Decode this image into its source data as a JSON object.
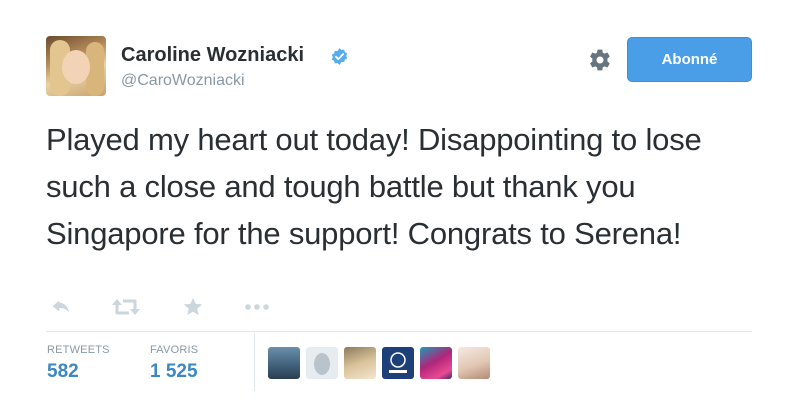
{
  "user": {
    "name": "Caroline Wozniacki",
    "handle": "@CaroWozniacki",
    "verified_icon": "verified-badge-icon",
    "avatar_icon": "profile-photo"
  },
  "header": {
    "settings_icon": "gear-icon",
    "follow_label": "Abonné",
    "follow_color": "#4a9ee8"
  },
  "tweet": {
    "text": "Played my heart out today! Disappointing to lose such a close and tough battle but thank you Singapore for the support! Congrats to Serena!"
  },
  "actions": [
    "reply-icon",
    "retweet-icon",
    "favorite-icon",
    "more-icon"
  ],
  "stats": {
    "retweets_label": "RETWEETS",
    "retweets_value": "582",
    "favorites_label": "FAVORIS",
    "favorites_value": "1 525"
  },
  "favorited_by": [
    "favoriter-avatar-1",
    "favoriter-avatar-2",
    "favoriter-avatar-3",
    "favoriter-avatar-4",
    "favoriter-avatar-5",
    "favoriter-avatar-6"
  ],
  "colors": {
    "text": "#292f33",
    "muted": "#8899a6",
    "link": "#3b88c3",
    "divider": "#e1e8ed"
  }
}
